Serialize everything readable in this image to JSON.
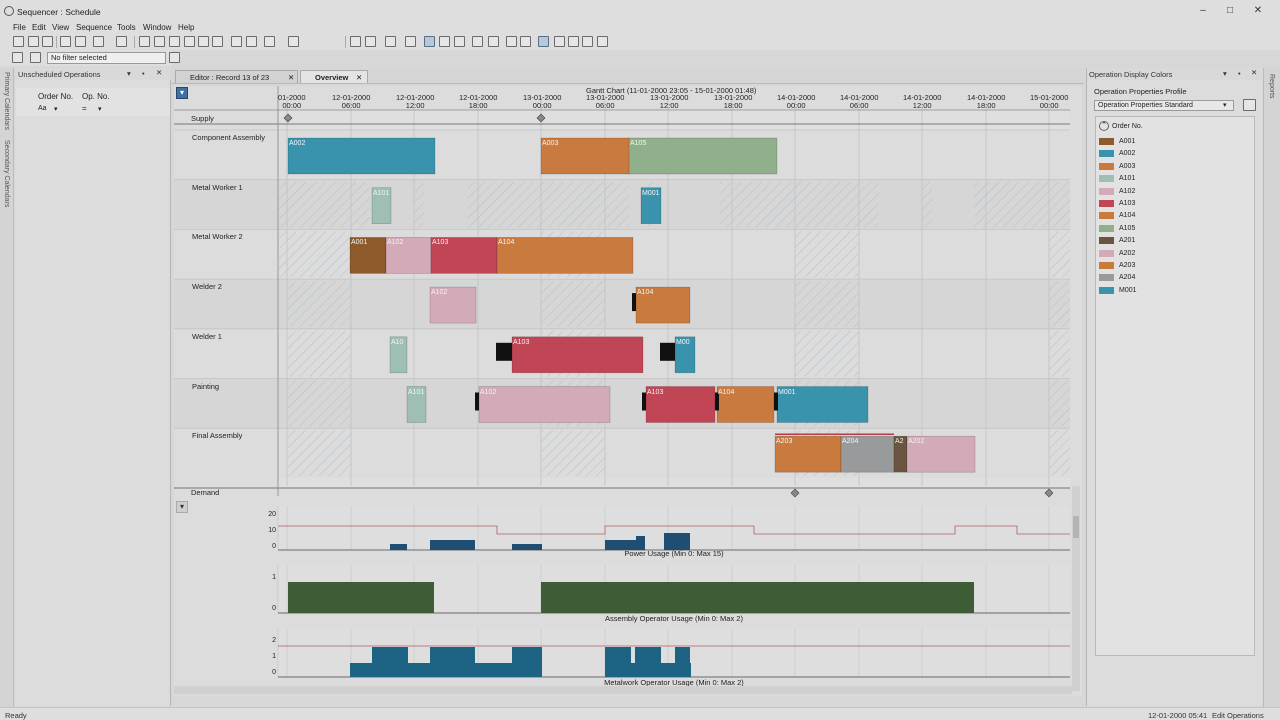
{
  "window": {
    "title": "Sequencer : Schedule"
  },
  "menu": [
    "File",
    "Edit",
    "View",
    "Sequence",
    "Tools",
    "Window",
    "Help"
  ],
  "filter": {
    "value": "No filter selected"
  },
  "left_strip": [
    "Primary Calendars",
    "Secondary Calendars"
  ],
  "right_strip": [
    "Reports"
  ],
  "unscheduled": {
    "title": "Unscheduled Operations",
    "col1": "Order No.",
    "col2": "Op. No.",
    "col1_filter": "Aa",
    "col2_filter": "="
  },
  "tabs": [
    {
      "label": "Editor : Record 13 of 23"
    },
    {
      "label": "Overview"
    }
  ],
  "gantt": {
    "title": "Gantt Chart   (11-01-2000 23:05 - 15-01-2000 01:48)",
    "time_labels": [
      {
        "d": "01-2000",
        "t": "00:00"
      },
      {
        "d": "12-01-2000",
        "t": "06:00"
      },
      {
        "d": "12-01-2000",
        "t": "12:00"
      },
      {
        "d": "12-01-2000",
        "t": "18:00"
      },
      {
        "d": "13-01-2000",
        "t": "00:00"
      },
      {
        "d": "13-01-2000",
        "t": "06:00"
      },
      {
        "d": "13-01-2000",
        "t": "12:00"
      },
      {
        "d": "13-01-2000",
        "t": "18:00"
      },
      {
        "d": "14-01-2000",
        "t": "00:00"
      },
      {
        "d": "14-01-2000",
        "t": "06:00"
      },
      {
        "d": "14-01-2000",
        "t": "12:00"
      },
      {
        "d": "14-01-2000",
        "t": "18:00"
      },
      {
        "d": "15-01-2000",
        "t": "00:00"
      }
    ],
    "supply_label": "Supply",
    "demand_label": "Demand",
    "lanes": [
      {
        "name": "Component Assembly",
        "bars": [
          {
            "label": "A002",
            "color": "#3a93ad"
          },
          {
            "label": "A003",
            "color": "#c97a3e"
          },
          {
            "label": "A105",
            "color": "#8fb08a"
          }
        ]
      },
      {
        "name": "Metal Worker 1",
        "bars": [
          {
            "label": "A101",
            "color": "#9fbfb3"
          },
          {
            "label": "M001",
            "color": "#3a93ad"
          }
        ]
      },
      {
        "name": "Metal Worker 2",
        "bars": [
          {
            "label": "A001",
            "color": "#8e5a2c"
          },
          {
            "label": "A102",
            "color": "#d3aab8"
          },
          {
            "label": "A103",
            "color": "#c04655"
          },
          {
            "label": "A104",
            "color": "#c97a3e"
          }
        ]
      },
      {
        "name": "Welder 2",
        "bars": [
          {
            "label": "A102",
            "color": "#d3aab8"
          },
          {
            "label": "A104",
            "color": "#c97a3e"
          }
        ]
      },
      {
        "name": "Welder 1",
        "bars": [
          {
            "label": "A10",
            "color": "#9fbfb3"
          },
          {
            "label": "A103",
            "color": "#c04655"
          },
          {
            "label": "M00",
            "color": "#3a93ad"
          }
        ]
      },
      {
        "name": "Painting",
        "bars": [
          {
            "label": "A101",
            "color": "#9fbfb3"
          },
          {
            "label": "A102",
            "color": "#d3aab8"
          },
          {
            "label": "A103",
            "color": "#c04655"
          },
          {
            "label": "A104",
            "color": "#c97a3e"
          },
          {
            "label": "M001",
            "color": "#3a93ad"
          }
        ]
      },
      {
        "name": "Final Assembly",
        "bars": [
          {
            "label": "A203",
            "color": "#c97a3e"
          },
          {
            "label": "A204",
            "color": "#999a9c"
          },
          {
            "label": "A2",
            "color": "#6b5541"
          },
          {
            "label": "A202",
            "color": "#d3aab8"
          }
        ]
      }
    ]
  },
  "usage_charts": [
    {
      "title": "Power Usage (Min 0: Max 15)",
      "ticks": [
        "20",
        "10",
        "0"
      ]
    },
    {
      "title": "Assembly Operator Usage (Min 0: Max 2)",
      "ticks": [
        "1",
        "0"
      ]
    },
    {
      "title": "Metalwork Operator Usage (Min 0: Max 2)",
      "ticks": [
        "2",
        "1",
        "0"
      ]
    }
  ],
  "op_colors": {
    "title": "Operation Display Colors",
    "profile_label": "Operation Properties Profile",
    "profile_value": "Operation Properties Standard",
    "group_label": "Order No.",
    "items": [
      {
        "label": "A001",
        "color": "#8e5a2c"
      },
      {
        "label": "A002",
        "color": "#3a93ad"
      },
      {
        "label": "A003",
        "color": "#c97a3e"
      },
      {
        "label": "A101",
        "color": "#9fbfb3"
      },
      {
        "label": "A102",
        "color": "#d3aab8"
      },
      {
        "label": "A103",
        "color": "#c04655"
      },
      {
        "label": "A104",
        "color": "#c97a3e"
      },
      {
        "label": "A105",
        "color": "#8fb08a"
      },
      {
        "label": "A201",
        "color": "#6b5541"
      },
      {
        "label": "A202",
        "color": "#d3aab8"
      },
      {
        "label": "A203",
        "color": "#c97a3e"
      },
      {
        "label": "A204",
        "color": "#999a9c"
      },
      {
        "label": "M001",
        "color": "#3a93ad"
      }
    ]
  },
  "status": {
    "left": "Ready",
    "time": "12-01-2000 05:41",
    "mode": "Edit Operations"
  }
}
